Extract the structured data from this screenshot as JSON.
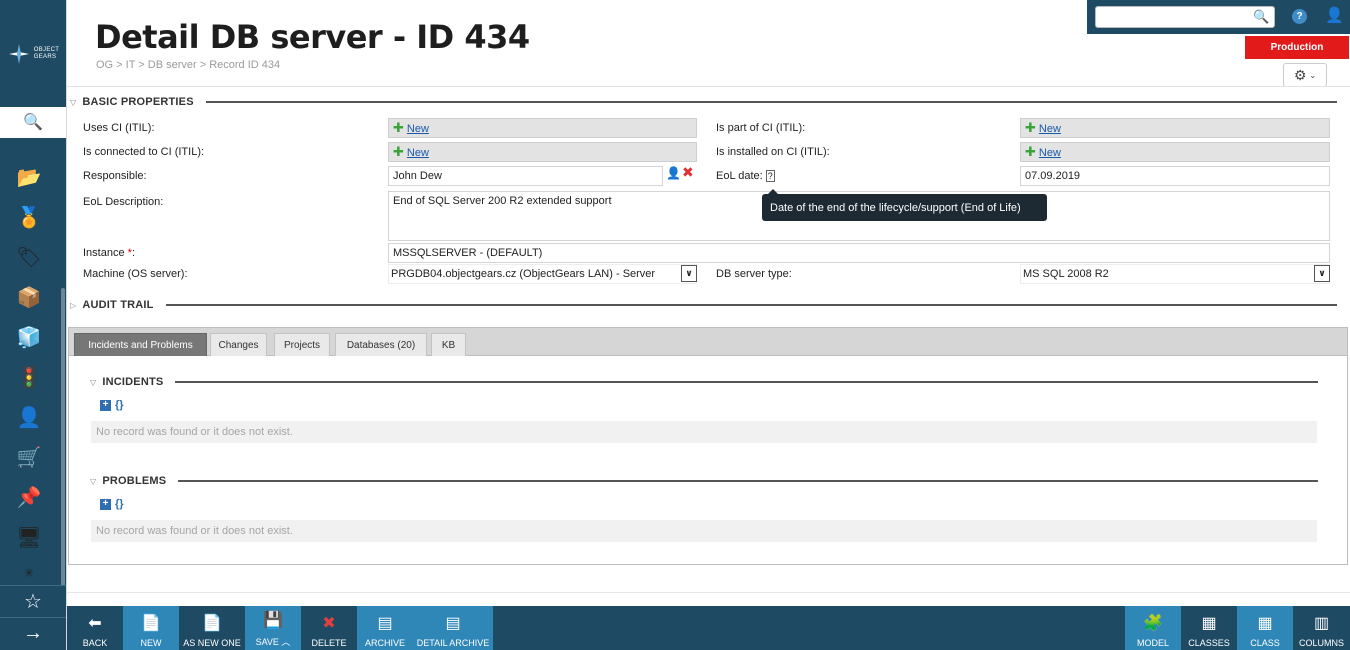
{
  "app": {
    "logo_text_1": "OBJECT",
    "logo_text_2": "GEARS"
  },
  "header": {
    "title": "Detail DB server - ID 434",
    "breadcrumb": "OG > IT > DB server > Record ID 434",
    "search_placeholder": "",
    "environment": "Production"
  },
  "sections": {
    "basic": "BASIC PROPERTIES",
    "audit": "AUDIT TRAIL",
    "incidents": "INCIDENTS",
    "problems": "PROBLEMS"
  },
  "form": {
    "uses_ci_label": "Uses CI (ITIL):",
    "is_part_of_label": "Is part of CI (ITIL):",
    "connected_label": "Is connected to CI (ITIL):",
    "installed_label": "Is installed on CI (ITIL):",
    "new_link": "New",
    "responsible_label": "Responsible:",
    "responsible_value": "John Dew",
    "eol_date_label": "EoL date:",
    "eol_date_value": "07.09.2019",
    "eol_desc_label": "EoL Description:",
    "eol_desc_value": "End of SQL Server 200 R2 extended support",
    "instance_label": "Instance",
    "instance_required": "*",
    "instance_suffix": ":",
    "instance_value": "MSSQLSERVER - (DEFAULT)",
    "machine_label": "Machine (OS server):",
    "machine_value": "PRGDB04.objectgears.cz (ObjectGears LAN) - Server",
    "dbtype_label": "DB server type:",
    "dbtype_value": "MS SQL 2008 R2",
    "tooltip": "Date of the end of the lifecycle/support (End of Life)"
  },
  "tabs": [
    {
      "label": "Incidents and Problems",
      "active": true
    },
    {
      "label": "Changes"
    },
    {
      "label": "Projects"
    },
    {
      "label": "Databases (20)"
    },
    {
      "label": "KB"
    }
  ],
  "empty_message": "No record was found or it does not exist.",
  "toolbar": {
    "back": "BACK",
    "new": "NEW",
    "as_new_one": "AS NEW ONE",
    "save": "SAVE",
    "delete": "DELETE",
    "archive": "ARCHIVE",
    "detail_archive": "DETAIL ARCHIVE",
    "model": "MODEL",
    "classes": "CLASSES",
    "class": "CLASS",
    "columns": "COLUMNS"
  },
  "colors": {
    "sidebar": "#1e4a63",
    "environment": "#e21a1a",
    "toolbar_light": "#2f87b8"
  }
}
